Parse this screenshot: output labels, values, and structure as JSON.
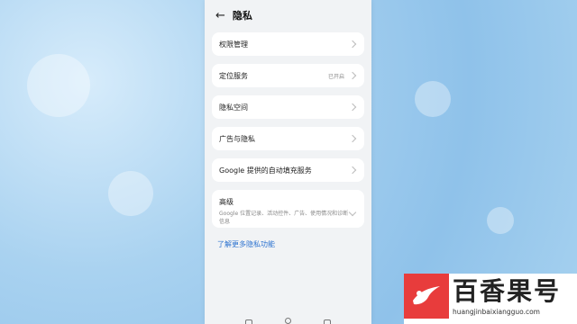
{
  "header": {
    "back_icon": "arrow-left-icon",
    "title": "隐私"
  },
  "items": [
    {
      "label": "权限管理",
      "value": ""
    },
    {
      "label": "定位服务",
      "value": "已开启"
    },
    {
      "label": "隐私空间",
      "value": ""
    },
    {
      "label": "广告与隐私",
      "value": ""
    },
    {
      "label": "Google 提供的自动填充服务",
      "value": ""
    }
  ],
  "advanced": {
    "title": "高级",
    "description": "Google 位置记录、活动控件、广告、使用情况和诊断信息"
  },
  "link": "了解更多隐私功能",
  "watermark": {
    "name": "百香果号",
    "url": "huangjinbaixiangguo.com",
    "logo_color": "#e83c3c"
  },
  "colors": {
    "accent": "#2f74d0",
    "background": "#f1f3f5"
  }
}
